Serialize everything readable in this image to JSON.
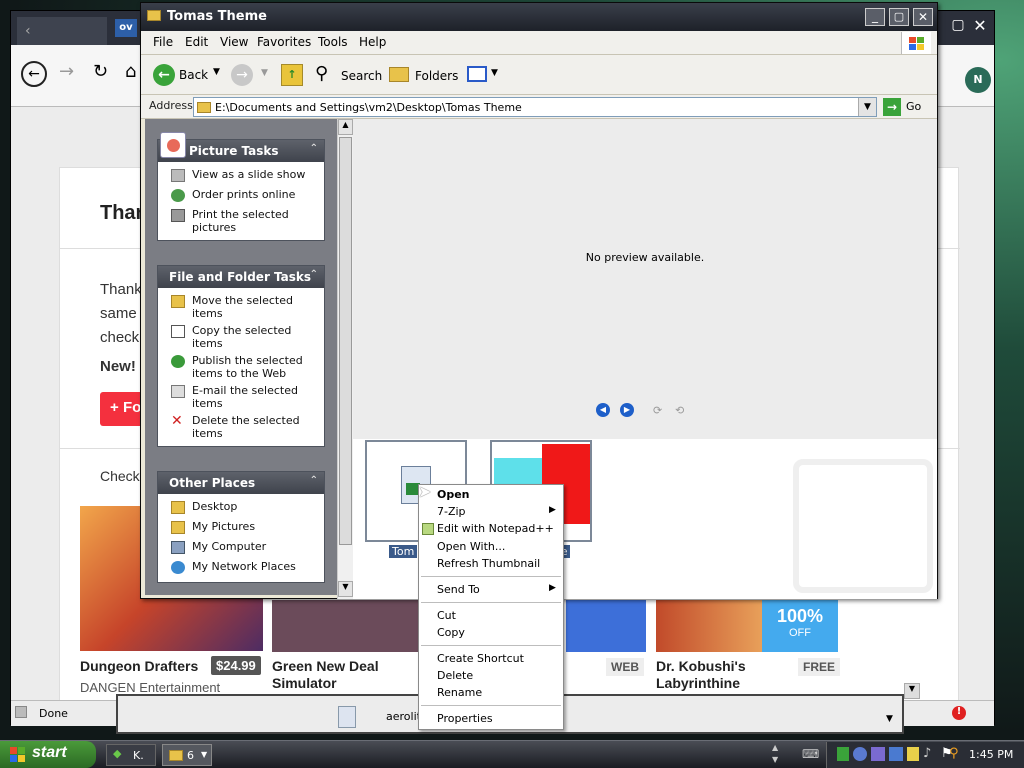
{
  "browser": {
    "status": "Done",
    "heading": "Thar",
    "body_lines": [
      "Thank",
      "same",
      "check"
    ],
    "new_label": "New!",
    "f_button": "Fo",
    "check_label": "Check",
    "games": [
      {
        "title": "Dungeon Drafters",
        "dev": "DANGEN Entertainment",
        "price": "$24.99"
      },
      {
        "title": "Green New Deal Simulator",
        "dev": "",
        "price": ""
      },
      {
        "title": "",
        "dev": "",
        "price": "WEB"
      },
      {
        "title": "Dr. Kobushi's Labyrinthine Laboratory",
        "dev": "",
        "price": "FREE"
      }
    ],
    "sale": "100%",
    "sale_off": "OFF",
    "tab_text": "ov",
    "download_name": "aerolite"
  },
  "explorer": {
    "title": "Tomas Theme",
    "menu": [
      "File",
      "Edit",
      "View",
      "Favorites",
      "Tools",
      "Help"
    ],
    "toolbar": {
      "back": "Back",
      "search": "Search",
      "folders": "Folders"
    },
    "address_label": "Address",
    "address_value": "E:\\Documents and Settings\\vm2\\Desktop\\Tomas Theme",
    "go_label": "Go",
    "preview_text": "No preview available.",
    "picture_tasks": {
      "title": "Picture Tasks",
      "items": [
        "View as a slide show",
        "Order prints online",
        "Print the selected pictures"
      ]
    },
    "file_tasks": {
      "title": "File and Folder Tasks",
      "items": [
        "Move the selected items",
        "Copy the selected items",
        "Publish the selected items to the Web",
        "E-mail the selected items",
        "Delete the selected items"
      ]
    },
    "other_places": {
      "title": "Other Places",
      "items": [
        "Desktop",
        "My Pictures",
        "My Computer",
        "My Network Places"
      ]
    },
    "thumb1_label": "Tom",
    "thumb2_label": "me"
  },
  "context_menu": {
    "items": [
      "Open",
      "7-Zip",
      "Edit with Notepad++",
      "Open With...",
      "Refresh Thumbnail",
      "Send To",
      "Cut",
      "Copy",
      "Create Shortcut",
      "Delete",
      "Rename",
      "Properties"
    ]
  },
  "taskbar": {
    "start": "start",
    "task1": "K.",
    "task2": "6",
    "clock": "1:45 PM"
  },
  "colors": {
    "accent_red": "#f4303e",
    "sale_blue": "#44aaee",
    "xp_start": "#3c8a2f"
  }
}
